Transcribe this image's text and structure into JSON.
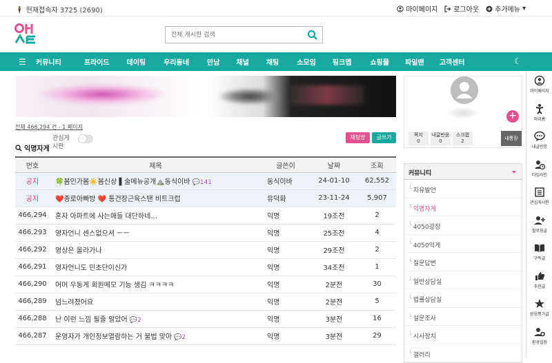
{
  "topbar": {
    "visitors": "현재접속자 3725 (2690)",
    "mypage": "마이페이지",
    "logout": "로그아웃",
    "more_menu": "추가메뉴"
  },
  "search": {
    "placeholder": "전체 게시판 검색"
  },
  "nav": {
    "items": [
      "커뮤니티",
      "프라이드",
      "데이팅",
      "우리동네",
      "만남",
      "채널",
      "채팅",
      "소모임",
      "핑크맵",
      "쇼핑몰",
      "파일맨",
      "고객센터"
    ]
  },
  "board": {
    "count": "전체 466,294 건 - 1 페이지",
    "title": "익명자게",
    "interest_label": "관심게시판",
    "btn_select": "채팅방",
    "btn_write": "글쓰기",
    "columns": [
      "번호",
      "제목",
      "글쓴이",
      "날짜",
      "조회"
    ],
    "rows": [
      {
        "num": "공지",
        "title": "🍀봄인가봄☀️봄신상 ▌술메뉴공개⛰️동식이바",
        "comments": "141",
        "author": "동식이바",
        "date": "24-01-10",
        "views": "62,552",
        "notice": true
      },
      {
        "num": "공지",
        "title": "❤️종로아빠방 ❤️ 통건장근육스탠 비트크럽",
        "comments": "",
        "author": "유덕화",
        "date": "23-11-24",
        "views": "5,907",
        "notice": true
      },
      {
        "num": "466,294",
        "title": "혼자 아파트에 사는애들 대단하네...",
        "comments": "",
        "author": "익명",
        "date": "19조전",
        "views": "2",
        "notice": false
      },
      {
        "num": "466,293",
        "title": "영자언니 센스없으셔 ㅡㅡ",
        "comments": "",
        "author": "익명",
        "date": "25조전",
        "views": "4",
        "notice": false
      },
      {
        "num": "466,292",
        "title": "영상은 올라가나",
        "comments": "",
        "author": "익명",
        "date": "29조전",
        "views": "2",
        "notice": false
      },
      {
        "num": "466,291",
        "title": "영자언니도 민초단이신가",
        "comments": "",
        "author": "익명",
        "date": "34조전",
        "views": "1",
        "notice": false
      },
      {
        "num": "466,290",
        "title": "어머 우동게 회원메모 기능 생김 ㅋㅋㅋㅋ",
        "comments": "",
        "author": "익명",
        "date": "2분전",
        "views": "30",
        "notice": false
      },
      {
        "num": "466,289",
        "title": "넘느려졌어요",
        "comments": "",
        "author": "익명",
        "date": "2분전",
        "views": "5",
        "notice": false
      },
      {
        "num": "466,288",
        "title": "난 이런 느낌 될줄 알았어",
        "comments": "2",
        "author": "익명",
        "date": "3분전",
        "views": "16",
        "notice": false
      },
      {
        "num": "466,287",
        "title": "운영자가 개인정보열람하는 거 불법 맞아",
        "comments": "2",
        "author": "익명",
        "date": "3분전",
        "views": "29",
        "notice": false
      }
    ]
  },
  "profile": {
    "stats": [
      {
        "label": "쪽지",
        "value": "0"
      },
      {
        "label": "내글반응",
        "value": "0"
      },
      {
        "label": "스크랩",
        "value": "2"
      }
    ],
    "message_btn": "내통장"
  },
  "community": {
    "title": "커뮤니티",
    "items": [
      "자유발언",
      "익명자게",
      "4050광장",
      "4050익게",
      "질문답변",
      "일반상담실",
      "법률상담실",
      "설문조사",
      "시사정치",
      "갤러리"
    ],
    "active": "익명자게"
  },
  "rightbar": {
    "items": [
      "마이페이지",
      "마이홈",
      "내글반응",
      "타임라인",
      "관심게시판",
      "팔로윙글",
      "구독글",
      "추천글",
      "받음평가글",
      "환경설정"
    ]
  },
  "colors": {
    "teal": "#17a8a0",
    "pink": "#e0528f"
  }
}
